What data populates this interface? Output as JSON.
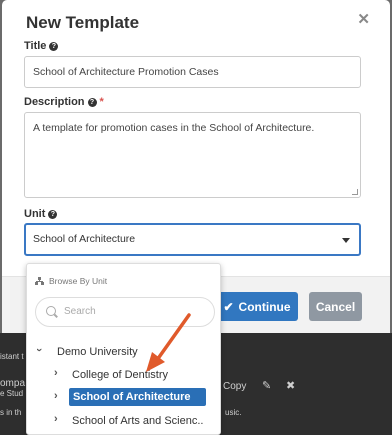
{
  "modal": {
    "title": "New Template",
    "close_glyph": "✕",
    "title_label": "Title",
    "title_value": "School of Architecture Promotion Cases",
    "description_label": "Description",
    "description_required": "*",
    "description_value": "A template for promotion cases in the School of Architecture.",
    "unit_label": "Unit",
    "unit_value": "School of Architecture",
    "continue_label": "Continue",
    "cancel_label": "Cancel"
  },
  "dropdown": {
    "header": "Browse By Unit",
    "search_placeholder": "Search",
    "items": [
      {
        "label": "Demo University",
        "chevron": "⌄"
      },
      {
        "label": "College of Dentistry",
        "chevron": "›"
      },
      {
        "label": "School of Architecture",
        "chevron": "›",
        "selected": true
      },
      {
        "label": "School of Arts and Scienc..",
        "chevron": "›"
      }
    ]
  },
  "background": {
    "fragments": [
      "istant t",
      "ompa",
      "e Stud",
      "s in th",
      "Copy",
      "usic."
    ]
  },
  "colors": {
    "accent": "#3177c0",
    "selected": "#2a6fb6",
    "cancel": "#8f98a2",
    "arrow": "#e05a2b"
  }
}
